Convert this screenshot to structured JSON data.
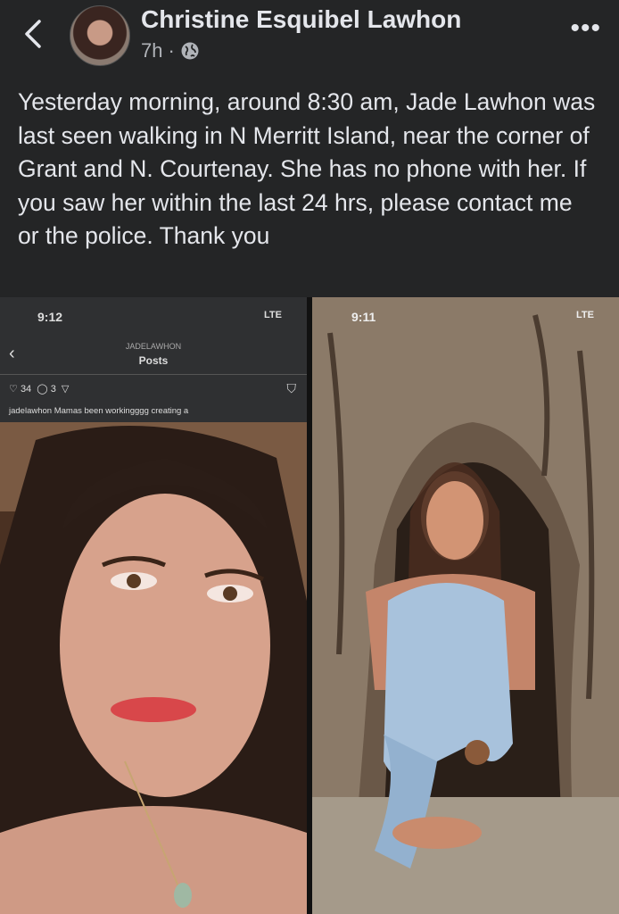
{
  "header": {
    "author_name": "Christine Esquibel Lawhon",
    "time": "7h",
    "separator": "·",
    "more_label": "•••"
  },
  "post": {
    "text": "Yesterday morning, around 8:30 am, Jade Lawhon was last seen walking in N Merritt Island, near the corner of Grant and N. Courtenay. She has no phone with her. If you saw her within the last 24 hrs, please contact me or the police. Thank you"
  },
  "photo_left": {
    "status_time": "9:12",
    "status_network": "LTE",
    "ig_username": "JADELAWHON",
    "ig_title": "Posts",
    "likes": "34",
    "comments": "3",
    "caption": "jadelawhon Mamas been workingggg",
    "caption_tail": "creating a"
  },
  "photo_right": {
    "status_time": "9:11",
    "status_network": "LTE"
  },
  "icons": {
    "back": "chevron-left-icon",
    "privacy": "globe-icon",
    "more": "more-dots-icon"
  }
}
